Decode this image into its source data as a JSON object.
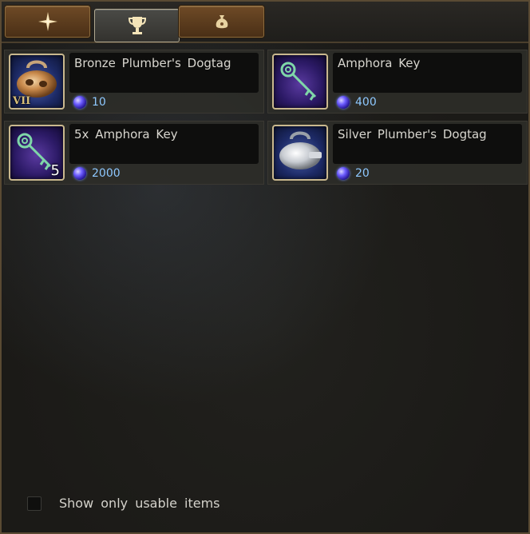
{
  "tabs": [
    {
      "icon": "compass-star-icon",
      "glyph": "✷",
      "active": false
    },
    {
      "icon": "trophy-icon",
      "glyph": "🏆",
      "active": true
    },
    {
      "icon": "money-bag-icon",
      "glyph": "♁",
      "active": false
    }
  ],
  "items": [
    {
      "name": "Bronze Plumber's Dogtag",
      "price": "10",
      "tier": "VII",
      "quantity": "",
      "icon": "bronze-dogtag-icon"
    },
    {
      "name": "Amphora Key",
      "price": "400",
      "tier": "",
      "quantity": "",
      "icon": "amphora-key-icon"
    },
    {
      "name": "5x Amphora Key",
      "price": "2000",
      "tier": "",
      "quantity": "5",
      "icon": "amphora-key-icon"
    },
    {
      "name": "Silver Plumber's Dogtag",
      "price": "20",
      "tier": "",
      "quantity": "",
      "icon": "silver-dogtag-icon"
    }
  ],
  "footer": {
    "checkbox_label": "Show only usable items",
    "checked": false
  },
  "colors": {
    "price_text": "#8ec8ff",
    "frame_border": "#5a4a33",
    "tab_bronze": "#6e4a26"
  }
}
